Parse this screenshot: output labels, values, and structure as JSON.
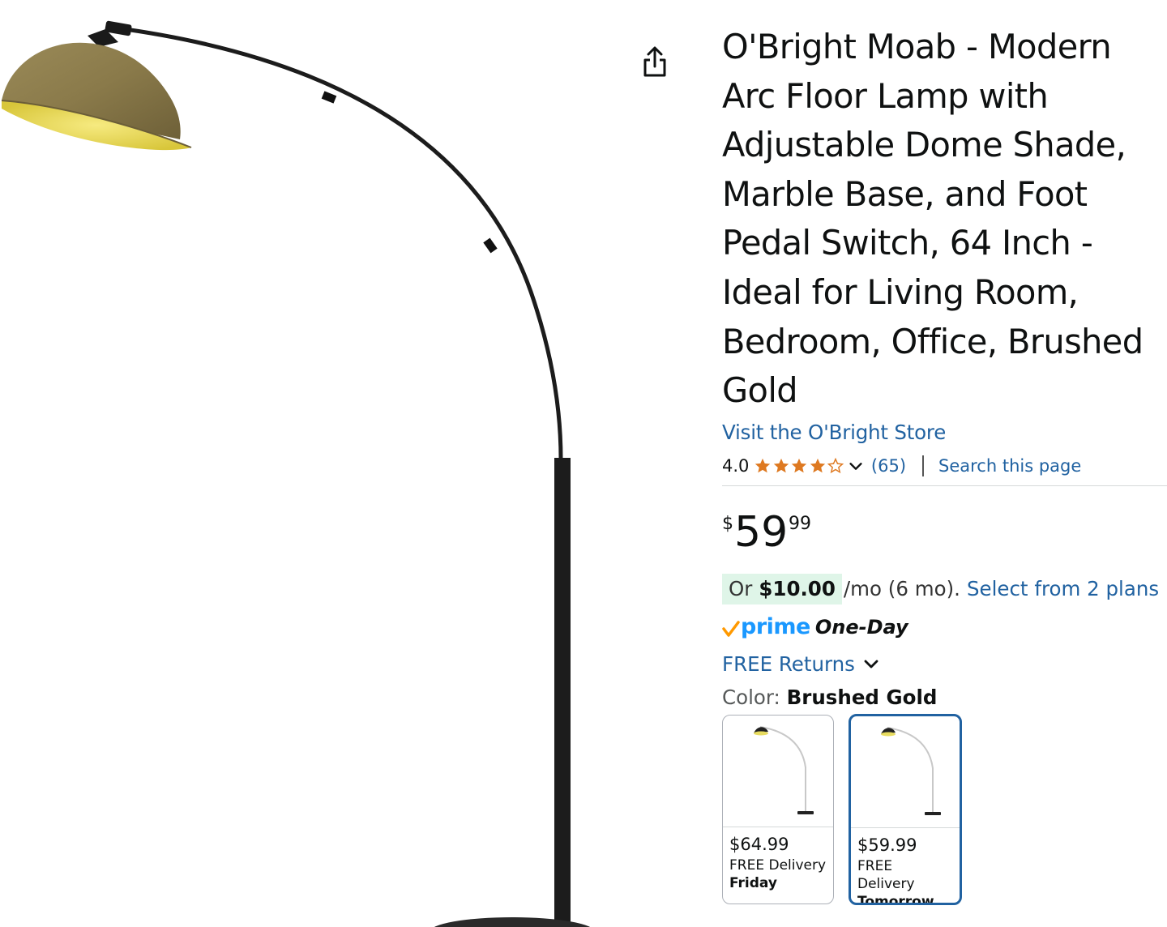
{
  "product": {
    "title": "O'Bright Moab - Modern Arc Floor Lamp with Adjustable Dome Shade, Marble Base, and Foot Pedal Switch, 64 Inch - Ideal for Living Room, Bedroom, Office, Brushed Gold",
    "store_link": "Visit the O'Bright Store"
  },
  "icons": {
    "share": "share-icon",
    "star": "star-icon",
    "chevron": "chevron-down-icon",
    "prime_check": "prime-check-icon"
  },
  "rating": {
    "value": "4.0",
    "stars": 4,
    "max_stars": 5,
    "count": "(65)",
    "search_link": "Search this page"
  },
  "price": {
    "symbol": "$",
    "whole": "59",
    "fraction": "99"
  },
  "installment": {
    "prefix": "Or",
    "amount": "$10.00",
    "suffix": "/mo (6 mo).",
    "link": "Select from 2 plans"
  },
  "prime": {
    "word": "prime",
    "badge": "One-Day"
  },
  "returns": {
    "label": "FREE Returns"
  },
  "color": {
    "label": "Color:",
    "value": "Brushed Gold"
  },
  "swatches": [
    {
      "price": "$64.99",
      "delivery": "FREE Delivery",
      "day": "Friday",
      "selected": false
    },
    {
      "price": "$59.99",
      "delivery": "FREE Delivery",
      "day": "Tomorrow",
      "selected": true
    }
  ],
  "colors": {
    "link": "#2162A1",
    "star": "#DE7921",
    "prime_blue": "#1A98FF",
    "prime_check": "#FF9900",
    "installment_bg": "#dff5e8",
    "shade": "#8a7a4a",
    "shade_inner": "#f0e060",
    "pole": "#1c1c1c"
  }
}
